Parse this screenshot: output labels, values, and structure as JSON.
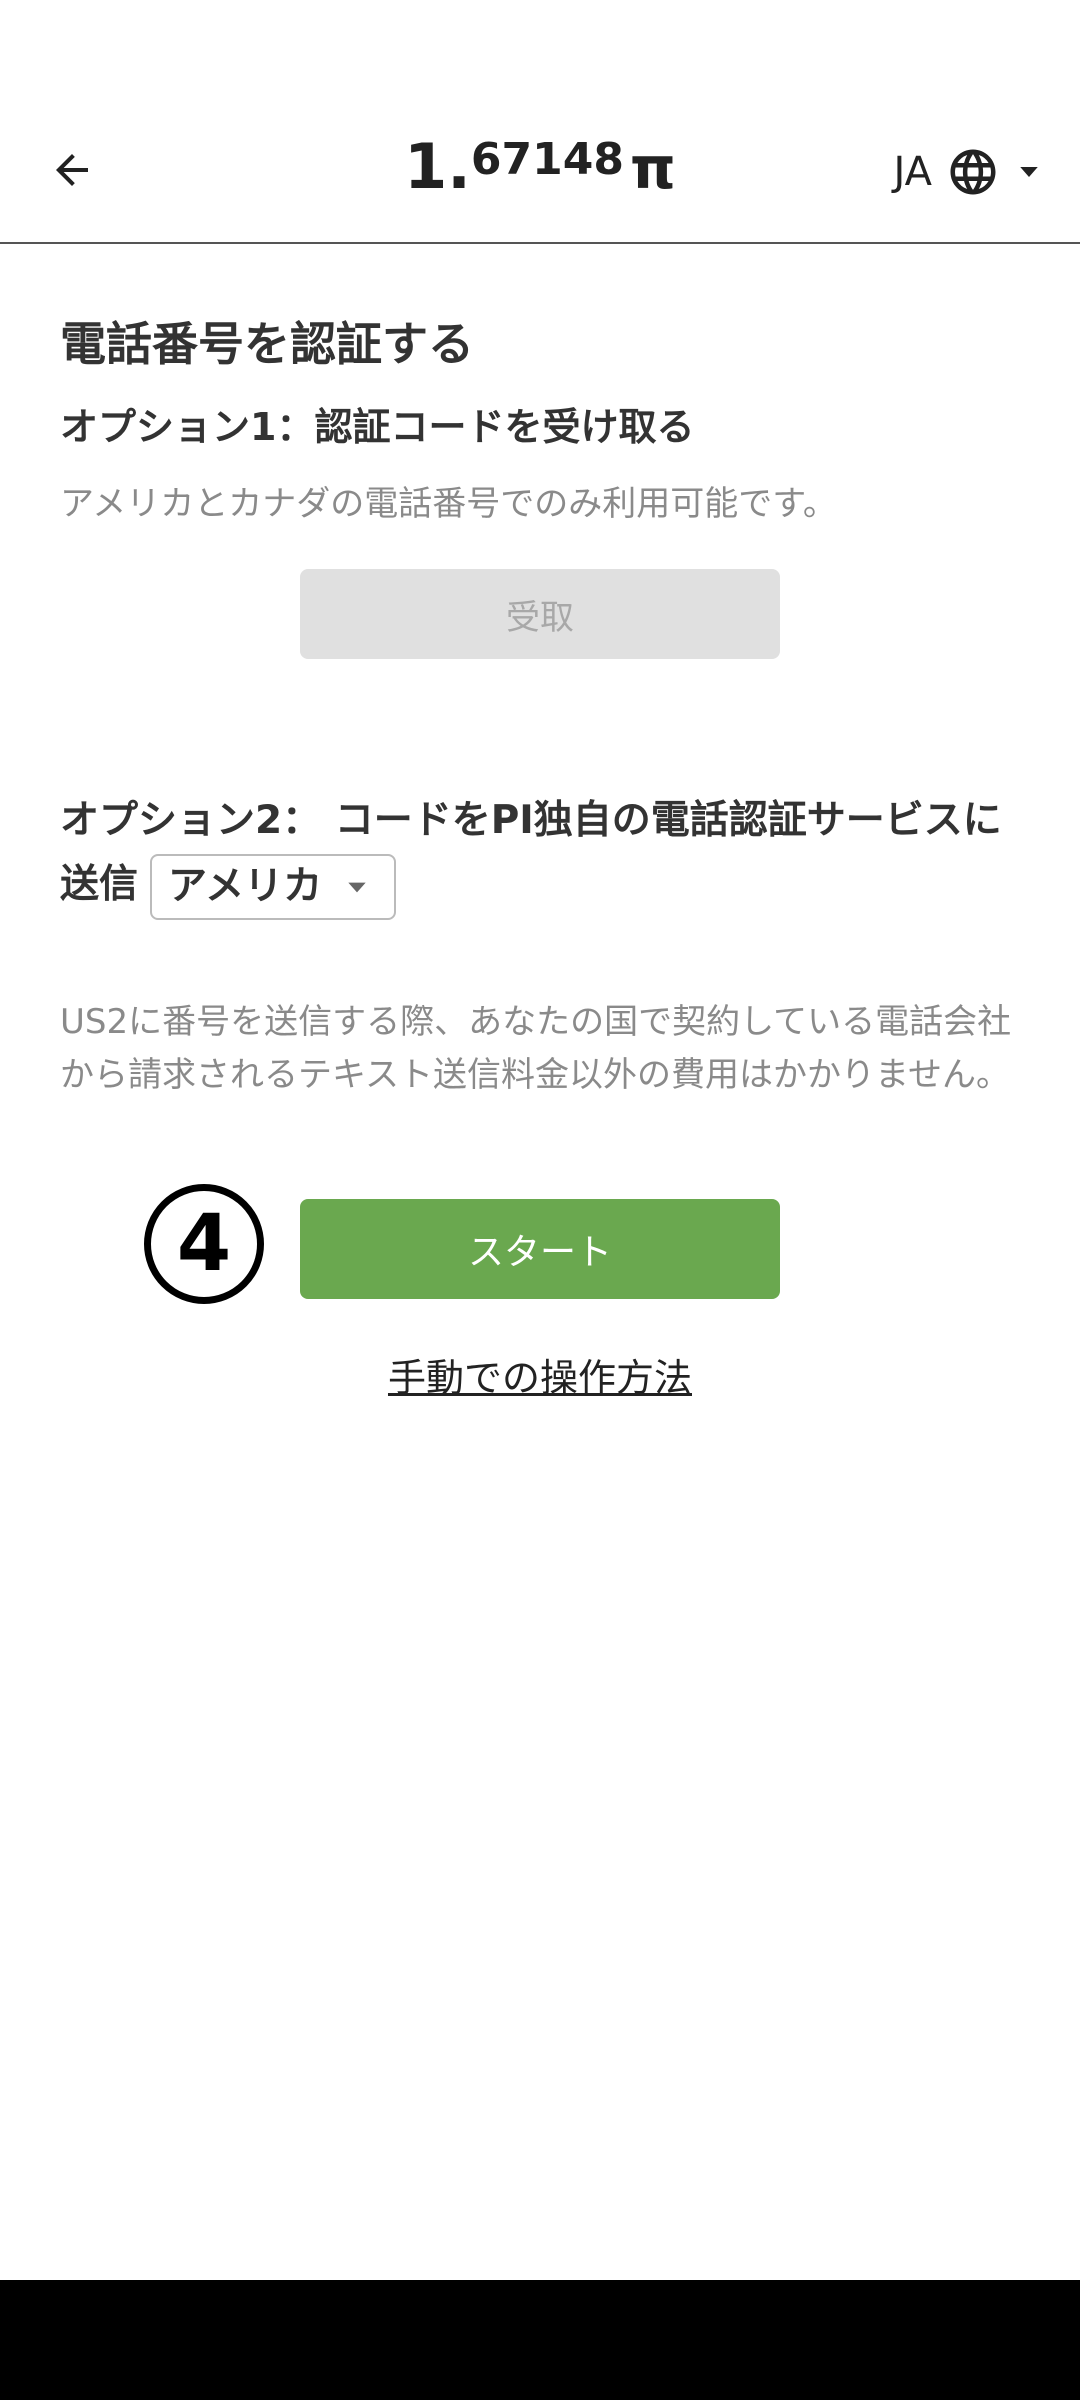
{
  "header": {
    "balance_int": "1.",
    "balance_frac": "67148",
    "currency_symbol": "π",
    "language_code": "JA"
  },
  "main": {
    "title": "電話番号を認証する",
    "option1": {
      "heading": "オプション1：認証コードを受け取る",
      "description": "アメリカとカナダの電話番号でのみ利用可能です。",
      "button_label": "受取"
    },
    "option2": {
      "heading": "オプション2： コードをPI独自の電話認証サービスに送信",
      "country_selected": "アメリカ",
      "description": "US2に番号を送信する際、あなたの国で契約している電話会社から請求されるテキスト送信料金以外の費用はかかりません。",
      "step_marker": "4",
      "start_button_label": "スタート"
    },
    "manual_link": "手動での操作方法"
  },
  "colors": {
    "start_button": "#6aa84f",
    "disabled_button": "#e0e0e0"
  }
}
